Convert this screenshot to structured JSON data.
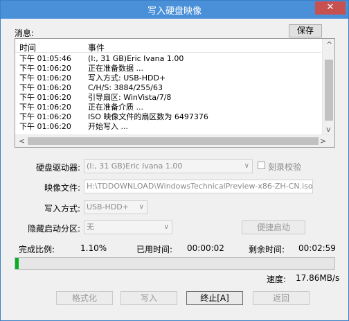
{
  "window": {
    "title": "写入硬盘映像",
    "close_glyph": "✕"
  },
  "messages": {
    "label": "消息:",
    "save_label": "保存",
    "columns": [
      "时间",
      "事件"
    ],
    "rows": [
      {
        "time": "下午 01:05:46",
        "event": "(I:, 31 GB)Eric    Ivana          1.00"
      },
      {
        "time": "下午 01:06:20",
        "event": "正在准备数据 ..."
      },
      {
        "time": "下午 01:06:20",
        "event": "写入方式: USB-HDD+"
      },
      {
        "time": "下午 01:06:20",
        "event": "C/H/S: 3884/255/63"
      },
      {
        "time": "下午 01:06:20",
        "event": "引导扇区: WinVista/7/8"
      },
      {
        "time": "下午 01:06:20",
        "event": "正在准备介质 ..."
      },
      {
        "time": "下午 01:06:20",
        "event": "ISO 映像文件的扇区数为 6497376"
      },
      {
        "time": "下午 01:06:20",
        "event": "开始写入 ..."
      }
    ]
  },
  "form": {
    "drive_label": "硬盘驱动器:",
    "drive_value": "(I:, 31 GB)Eric    Ivana          1.00",
    "verify_label": "刻录校验",
    "image_label": "映像文件:",
    "image_value": "H:\\TDDOWNLOAD\\WindowsTechnicalPreview-x86-ZH-CN.iso",
    "write_mode_label": "写入方式:",
    "write_mode_value": "USB-HDD+",
    "hidden_part_label": "隐藏启动分区:",
    "hidden_part_value": "无",
    "easy_boot_label": "便捷启动"
  },
  "status": {
    "percent_label": "完成比例:",
    "percent_value": "1.10%",
    "elapsed_label": "已用时间:",
    "elapsed_value": "00:00:02",
    "remaining_label": "剩余时间:",
    "remaining_value": "00:02:59",
    "progress_fraction": 0.011,
    "speed_label": "速度:",
    "speed_value": "17.86MB/s"
  },
  "buttons": {
    "format": "格式化",
    "write": "写入",
    "stop": "终止[A]",
    "back": "返回"
  },
  "colors": {
    "titlebar": "#4a90d9",
    "close": "#c75050",
    "progress": "#06b025"
  }
}
